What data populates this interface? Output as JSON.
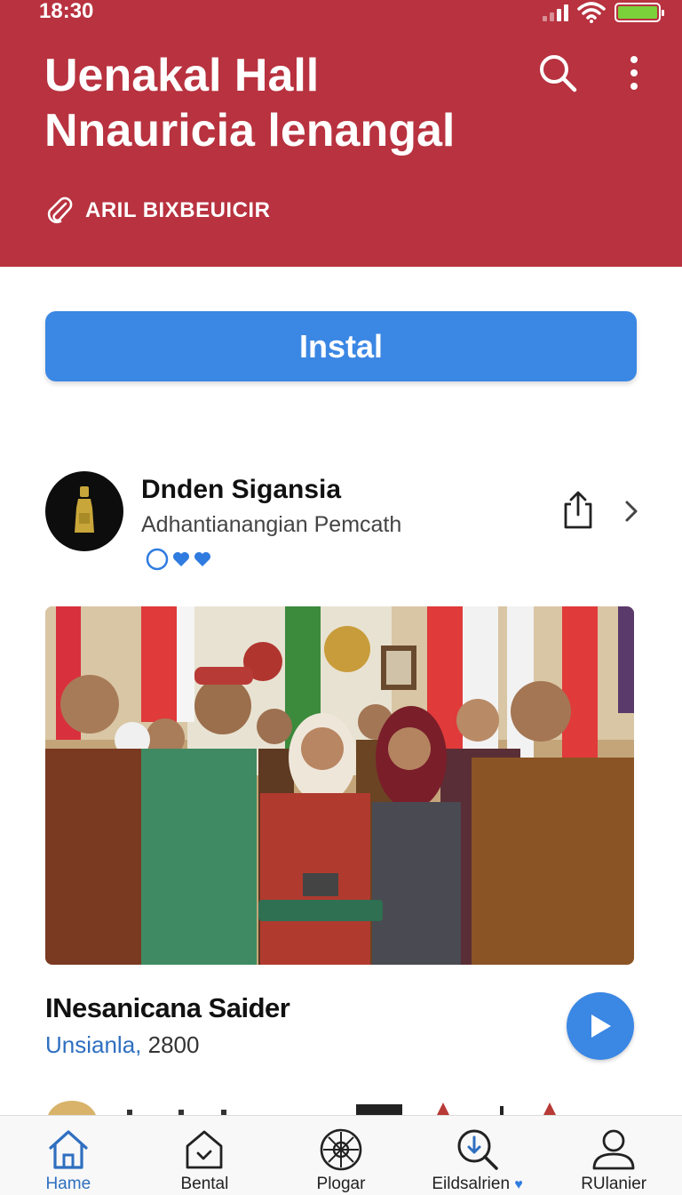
{
  "status_bar": {
    "time": "18:30",
    "battery_level": 1.0,
    "signal_bars": 2,
    "icons": [
      "signal-icon",
      "wifi-icon",
      "battery-icon"
    ]
  },
  "header": {
    "title_line1": "Uenakal Hall",
    "title_line2": "Nnauricia lenangal",
    "tag": "ARIL BIXBEUICIR",
    "background_color": "#b8323f",
    "icons": [
      "search-icon",
      "more-vertical-icon",
      "paperclip-icon"
    ]
  },
  "install": {
    "label": "Instal",
    "color": "#3b87e4"
  },
  "publisher": {
    "name": "Dnden Sigansia",
    "subtitle": "Adhantianangian Pemcath",
    "rating_icons": [
      "circle-outline-icon",
      "heart-icon",
      "heart-icon"
    ],
    "icons": [
      "share-icon",
      "chevron-right-icon"
    ]
  },
  "feature": {
    "image_description": "group-photo",
    "title": "INesanicana Saider",
    "location": "Unsianla,",
    "number": "2800",
    "action_icon": "play-icon"
  },
  "bottom_nav": {
    "items": [
      {
        "label": "Hame",
        "icon": "home-icon",
        "active": true
      },
      {
        "label": "Bental",
        "icon": "house-check-icon",
        "active": false
      },
      {
        "label": "Plogar",
        "icon": "ornament-icon",
        "active": false
      },
      {
        "label": "Eildsalrien",
        "icon": "download-search-icon",
        "active": false,
        "badge": "♥"
      },
      {
        "label": "RUlanier",
        "icon": "profile-icon",
        "active": false
      }
    ],
    "active_color": "#2f6fc0"
  }
}
